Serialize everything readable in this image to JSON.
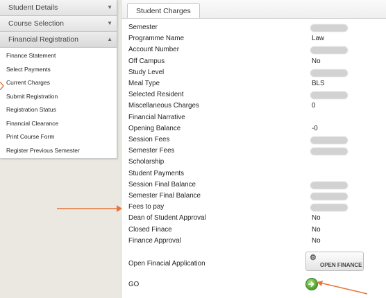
{
  "sidebar": {
    "sections": [
      {
        "label": "Student Details",
        "state": "collapsed"
      },
      {
        "label": "Course Selection",
        "state": "collapsed"
      },
      {
        "label": "Financial Registration",
        "state": "expanded"
      }
    ],
    "items": [
      "Finance Statement",
      "Select Payments",
      "Current Charges",
      "Submit Registration",
      "Registration Status",
      "Financial Clearance",
      "Print Course Form",
      "Register Previous Semester"
    ]
  },
  "main": {
    "tab": "Student Charges",
    "rows": [
      {
        "label": "Semester",
        "value": null,
        "redacted": true
      },
      {
        "label": "Programme Name",
        "value": "Law",
        "redacted": false
      },
      {
        "label": "Account Number",
        "value": null,
        "redacted": true
      },
      {
        "label": "Off Campus",
        "value": "No",
        "redacted": false
      },
      {
        "label": "Study Level",
        "value": null,
        "redacted": true
      },
      {
        "label": "Meal Type",
        "value": "BLS",
        "redacted": false
      },
      {
        "label": "Selected Resident",
        "value": null,
        "redacted": true
      },
      {
        "label": "Miscellaneous Charges",
        "value": "0",
        "redacted": false
      },
      {
        "label": "Financial Narrative",
        "value": "",
        "redacted": false
      },
      {
        "label": "Opening Balance",
        "value": "-0",
        "redacted": false
      },
      {
        "label": "Session Fees",
        "value": null,
        "redacted": true
      },
      {
        "label": "Semester Fees",
        "value": null,
        "redacted": true
      },
      {
        "label": "Scholarship",
        "value": "",
        "redacted": false
      },
      {
        "label": "Student Payments",
        "value": "",
        "redacted": false
      },
      {
        "label": "Session Final Balance",
        "value": null,
        "redacted": true
      },
      {
        "label": "Semester Final Balance",
        "value": null,
        "redacted": true
      },
      {
        "label": "Fees to pay",
        "value": null,
        "redacted": true
      },
      {
        "label": "Dean of Student Approval",
        "value": "No",
        "redacted": false
      },
      {
        "label": "Closed Finace",
        "value": "No",
        "redacted": false
      },
      {
        "label": "Finance Approval",
        "value": "No",
        "redacted": false
      }
    ],
    "open_application_label": "Open Finacial Application",
    "open_finance_button": "OPEN FINANCE",
    "go_label": "GO"
  },
  "colors": {
    "annotation_arrow": "#e8743b",
    "go_button": "#5cb33a"
  },
  "icons": {
    "open_finance": "gear-icon",
    "go": "right-arrow-icon",
    "collapsed": "chevron-down-icon",
    "expanded": "chevron-up-icon"
  }
}
